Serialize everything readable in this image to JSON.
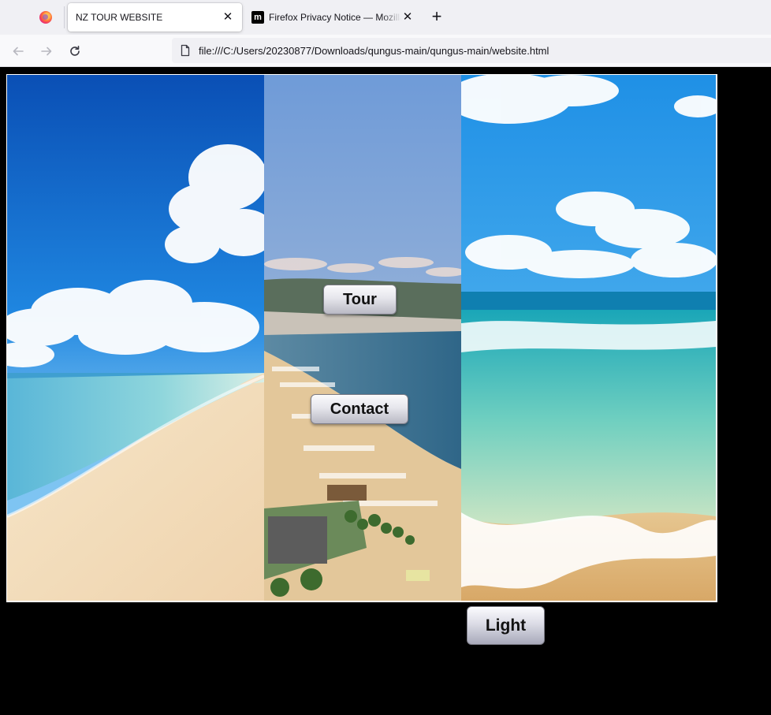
{
  "browser": {
    "tabs": [
      {
        "title": "NZ TOUR WEBSITE",
        "active": true
      },
      {
        "title": "Firefox Privacy Notice — Mozilla",
        "active": false,
        "favicon_letter": "m"
      }
    ],
    "new_tab_label": "+",
    "close_glyph": "✕",
    "url": "file:///C:/Users/20230877/Downloads/qungus-main/qungus-main/website.html",
    "icons": [
      "firefox-icon",
      "back-icon",
      "forward-icon",
      "reload-icon",
      "page-icon"
    ]
  },
  "page": {
    "background": "#000000",
    "buttons": {
      "tour": "Tour",
      "contact": "Contact",
      "light": "Light"
    },
    "images": [
      "beach-left-image",
      "resort-coast-image",
      "surf-right-image"
    ]
  }
}
